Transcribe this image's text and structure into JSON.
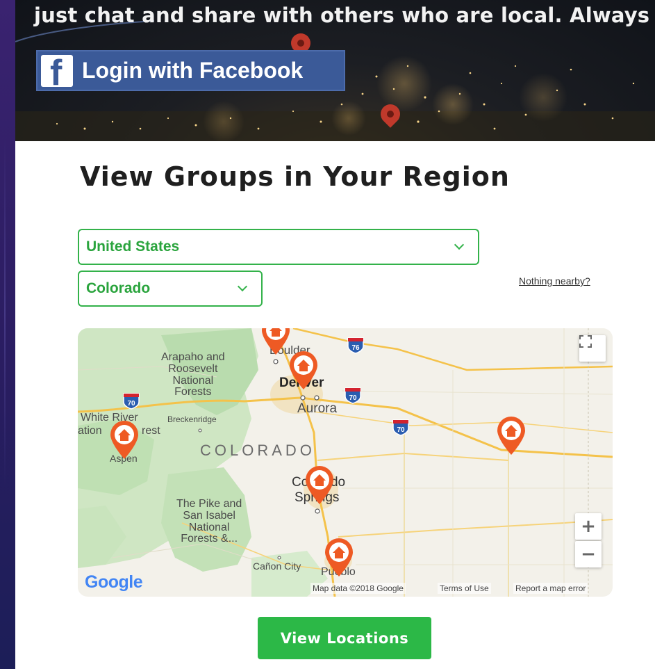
{
  "hero": {
    "tagline": "just chat and share with others who are local. Always free.",
    "facebook_button": "Login with Facebook",
    "facebook_icon": "f"
  },
  "section": {
    "title": "View Groups in Your Region"
  },
  "filters": {
    "country": "United States",
    "state": "Colorado",
    "nothing_nearby": "Nothing nearby?"
  },
  "map": {
    "labels": {
      "arapaho": "Arapaho and\nRoosevelt\nNational\nForests",
      "boulder": "Boulder",
      "denver": "Denver",
      "aurora": "Aurora",
      "white_river": "White River",
      "ation": "ation",
      "rest": "rest",
      "breckenridge": "Breckenridge",
      "colorado": "COLORADO",
      "aspen": "Aspen",
      "colorado_springs_1": "Colorado",
      "colorado_springs_2": "Springs",
      "pike": "The Pike and\nSan Isabel\nNational\nForests &...",
      "canon_city": "Cañon City",
      "pueblo": "Pueblo"
    },
    "shields": [
      "76",
      "70",
      "70",
      "70"
    ],
    "google": "Google",
    "attribution": "Map data ©2018 Google",
    "terms": "Terms of Use",
    "report": "Report a map error",
    "zoom_in": "+",
    "zoom_out": "−"
  },
  "cta": {
    "view_locations": "View Locations"
  },
  "colors": {
    "accent_green": "#2cb847",
    "pin_orange": "#ee5a24",
    "facebook_blue": "#3b5a98"
  }
}
